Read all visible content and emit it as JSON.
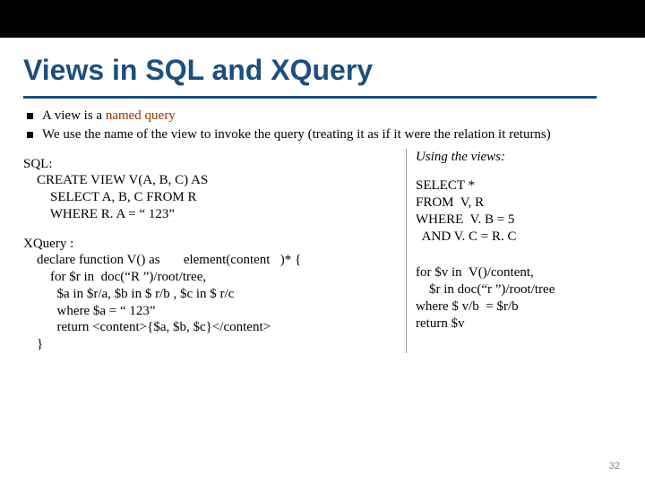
{
  "title": "Views in SQL and XQuery",
  "bullets": {
    "b1a": "A view is a ",
    "b1b": "named query",
    "b2": "We use the name of the view to invoke the query (treating it as if it were the relation it returns)"
  },
  "using_heading": "Using the views:",
  "sql": {
    "label": "SQL:",
    "code": "    CREATE VIEW V(A, B, C) AS\n        SELECT A, B, C FROM R\n        WHERE R. A = “ 123”"
  },
  "xq": {
    "label": "XQuery :",
    "code": "    declare function V() as       element(content   )* {\n        for $r in  doc(“R ”)/root/tree,\n          $a in $r/a, $b in $ r/b , $c in $ r/c\n          where $a = “ 123”\n          return <content>{$a, $b, $c}</content>\n    }"
  },
  "r_sql": "SELECT *\nFROM  V, R\nWHERE  V. B = 5\n  AND V. C = R. C",
  "r_xq": "for $v in  V()/content,\n    $r in doc(“r ”)/root/tree\nwhere $ v/b  = $r/b\nreturn $v",
  "page": "32"
}
